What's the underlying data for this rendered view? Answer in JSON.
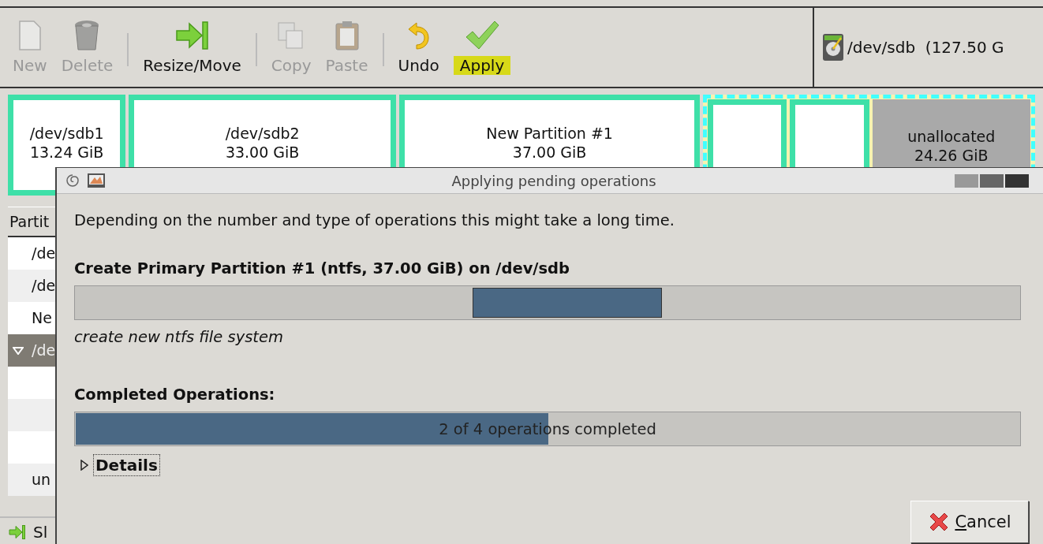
{
  "toolbar": {
    "items": [
      {
        "kind": "button",
        "label": "New",
        "disabled": true
      },
      {
        "kind": "button",
        "label": "Delete",
        "disabled": true
      },
      {
        "kind": "separator"
      },
      {
        "kind": "button",
        "label": "Resize/Move",
        "disabled": false
      },
      {
        "kind": "separator"
      },
      {
        "kind": "button",
        "label": "Copy",
        "disabled": true
      },
      {
        "kind": "button",
        "label": "Paste",
        "disabled": true
      },
      {
        "kind": "separator"
      },
      {
        "kind": "button",
        "label": "Undo",
        "disabled": false
      },
      {
        "kind": "button",
        "label": "Apply",
        "disabled": false,
        "highlighted": true
      }
    ]
  },
  "device": {
    "label": "/dev/sdb  (127.50 G"
  },
  "partition_map": [
    {
      "kind": "primary",
      "name": "/dev/sdb1",
      "size": "13.24 GiB"
    },
    {
      "kind": "primary",
      "name": "/dev/sdb2",
      "size": "33.00 GiB"
    },
    {
      "kind": "primary",
      "name": "New Partition #1",
      "size": "37.00 GiB"
    },
    {
      "kind": "extended",
      "children": [
        {
          "kind": "logical"
        },
        {
          "kind": "logical"
        },
        {
          "kind": "unallocated",
          "name": "unallocated",
          "size": "24.26 GiB"
        }
      ]
    }
  ],
  "partition_list": {
    "header": "Partit",
    "rows": [
      {
        "text": "/de",
        "selected": false,
        "expander": false
      },
      {
        "text": "/de",
        "selected": false,
        "expander": false
      },
      {
        "text": "Ne",
        "selected": false,
        "expander": false
      },
      {
        "text": "/de",
        "selected": true,
        "expander": true
      },
      {
        "selected": false,
        "expander": false
      },
      {
        "selected": false,
        "expander": false
      },
      {
        "selected": false,
        "expander": false
      },
      {
        "text": "un",
        "selected": false,
        "expander": false
      }
    ]
  },
  "status_bar": {
    "text": "Sl"
  },
  "dialog": {
    "title": "Applying pending operations",
    "message": "Depending on the number and type of operations this might take a long time.",
    "current_operation": "Create Primary Partition #1 (ntfs, 37.00 GiB) on /dev/sdb",
    "current_progress": {
      "indeterminate": true
    },
    "sub_operation": "create new ntfs file system",
    "completed_heading": "Completed Operations:",
    "completed": {
      "level": 0.5,
      "text": "2 of 4 operations completed"
    },
    "details": {
      "label": "Details",
      "expanded": false
    },
    "cancel": "Cancel"
  }
}
